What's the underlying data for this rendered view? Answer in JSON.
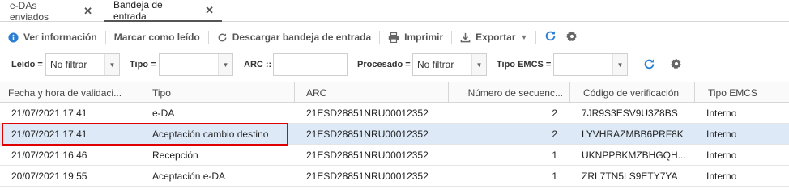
{
  "tabs": [
    {
      "label": "e-DAs enviados",
      "active": false
    },
    {
      "label": "Bandeja de entrada",
      "active": true
    }
  ],
  "toolbar": {
    "ver_informacion": "Ver información",
    "marcar_leido": "Marcar como leído",
    "descargar_bandeja": "Descargar bandeja de entrada",
    "imprimir": "Imprimir",
    "exportar": "Exportar"
  },
  "filters": {
    "leido_label": "Leído =",
    "leido_value": "No filtrar",
    "tipo_label": "Tipo =",
    "tipo_value": "",
    "arc_label": "ARC ::",
    "arc_value": "",
    "procesado_label": "Procesado =",
    "procesado_value": "No filtrar",
    "tipo_emcs_label": "Tipo EMCS =",
    "tipo_emcs_value": ""
  },
  "columns": [
    "Fecha y hora de validaci...",
    "Tipo",
    "ARC",
    "Número de secuenc...",
    "Código de verificación",
    "Tipo EMCS"
  ],
  "rows": [
    {
      "fecha": "21/07/2021 17:41",
      "tipo": "e-DA",
      "arc": "21ESD28851NRU00012352",
      "num": "2",
      "codigo": "7JR9S3ESV9U3Z8BS",
      "emcs": "Interno",
      "selected": false
    },
    {
      "fecha": "21/07/2021 17:41",
      "tipo": "Aceptación cambio destino",
      "arc": "21ESD28851NRU00012352",
      "num": "2",
      "codigo": "LYVHRAZMBB6PRF8K",
      "emcs": "Interno",
      "selected": true
    },
    {
      "fecha": "21/07/2021 16:46",
      "tipo": "Recepción",
      "arc": "21ESD28851NRU00012352",
      "num": "1",
      "codigo": "UKNPPBKMZBHGQH...",
      "emcs": "Interno",
      "selected": false
    },
    {
      "fecha": "20/07/2021 19:55",
      "tipo": "Aceptación e-DA",
      "arc": "21ESD28851NRU00012352",
      "num": "1",
      "codigo": "ZRL7TN5LS9ETY7YA",
      "emcs": "Interno",
      "selected": false
    }
  ],
  "icons": {
    "info": "info-icon",
    "refresh": "refresh-icon",
    "printer": "printer-icon",
    "download": "download-icon",
    "gear": "gear-icon"
  },
  "colors": {
    "accent_blue": "#2a7fd4",
    "selected_row": "#dde9f7",
    "highlight_red": "#e00000"
  }
}
